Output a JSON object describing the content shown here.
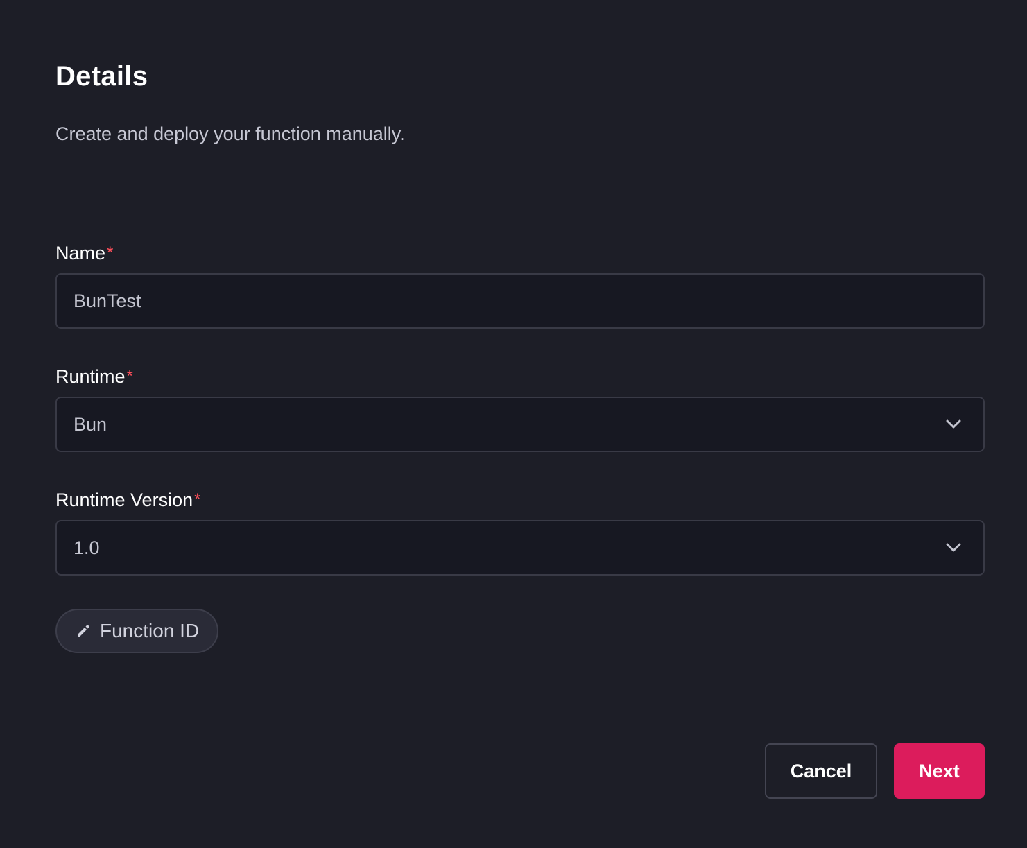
{
  "header": {
    "title": "Details",
    "subtitle": "Create and deploy your function manually."
  },
  "form": {
    "name": {
      "label": "Name",
      "required_mark": "*",
      "value": "BunTest"
    },
    "runtime": {
      "label": "Runtime",
      "required_mark": "*",
      "value": "Bun"
    },
    "runtime_version": {
      "label": "Runtime Version",
      "required_mark": "*",
      "value": "1.0"
    },
    "function_id_button": {
      "label": "Function ID",
      "icon": "pencil-icon"
    }
  },
  "footer": {
    "cancel_label": "Cancel",
    "next_label": "Next"
  },
  "colors": {
    "background": "#1d1e27",
    "input_background": "#171822",
    "accent": "#dc1c5c",
    "required": "#ff4f5b"
  }
}
